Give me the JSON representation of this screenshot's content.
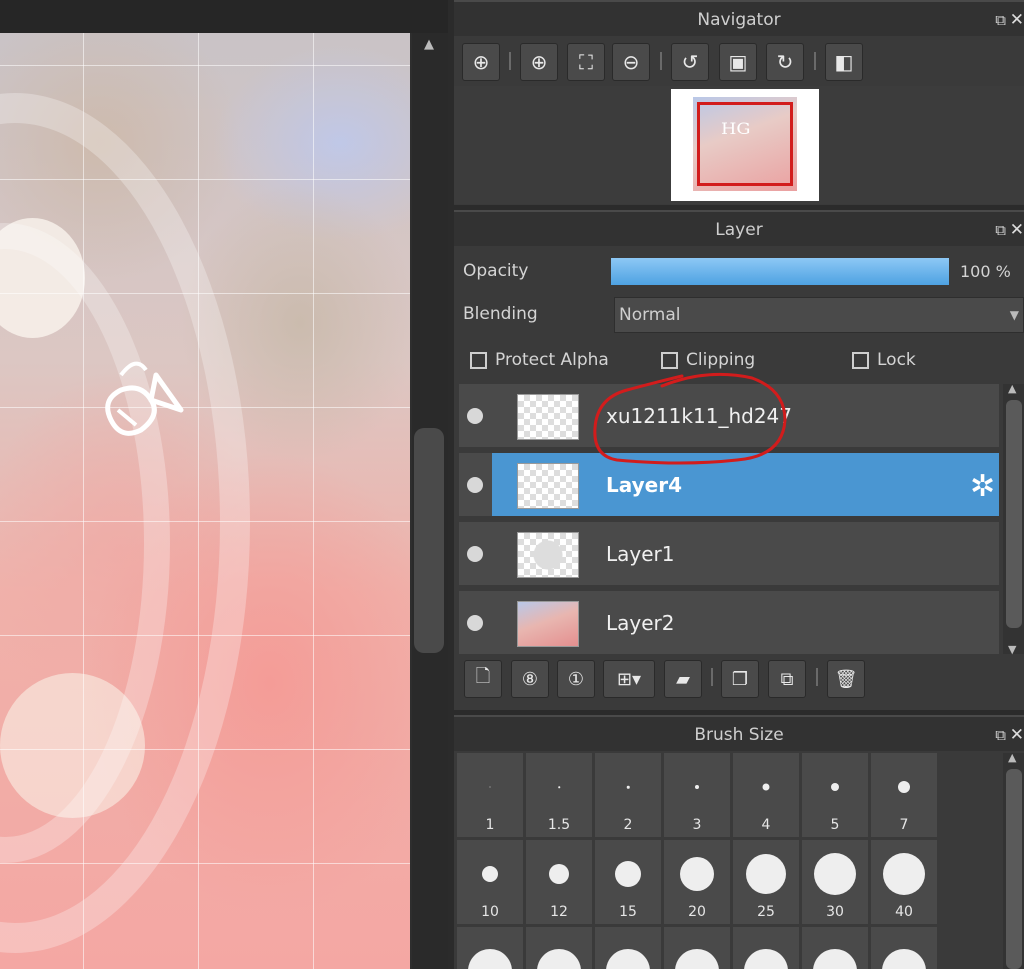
{
  "navigator": {
    "title": "Navigator",
    "tools": [
      "zoom-fit-icon",
      "zoom-in-icon",
      "fit-window-icon",
      "zoom-out-icon",
      "rotate-left-icon",
      "actual-size-icon",
      "rotate-right-icon",
      "flip-icon"
    ]
  },
  "layer": {
    "title": "Layer",
    "opacity_label": "Opacity",
    "opacity_value": "100 %",
    "opacity_percent": 100,
    "blending_label": "Blending",
    "blending_value": "Normal",
    "protect_alpha": "Protect Alpha",
    "clipping": "Clipping",
    "lock": "Lock",
    "rows": [
      {
        "name": "xu1211k11_hd247",
        "selected": false
      },
      {
        "name": "Layer4",
        "selected": true
      },
      {
        "name": "Layer1",
        "selected": false
      },
      {
        "name": "Layer2",
        "selected": false
      }
    ],
    "selected_color": "#4a96d2",
    "annotation_color": "#d21c1c"
  },
  "brush": {
    "title": "Brush Size",
    "sizes_row1": [
      "1",
      "1.5",
      "2",
      "3",
      "4",
      "5",
      "7"
    ],
    "sizes_row2": [
      "10",
      "12",
      "15",
      "20",
      "25",
      "30",
      "40"
    ]
  }
}
